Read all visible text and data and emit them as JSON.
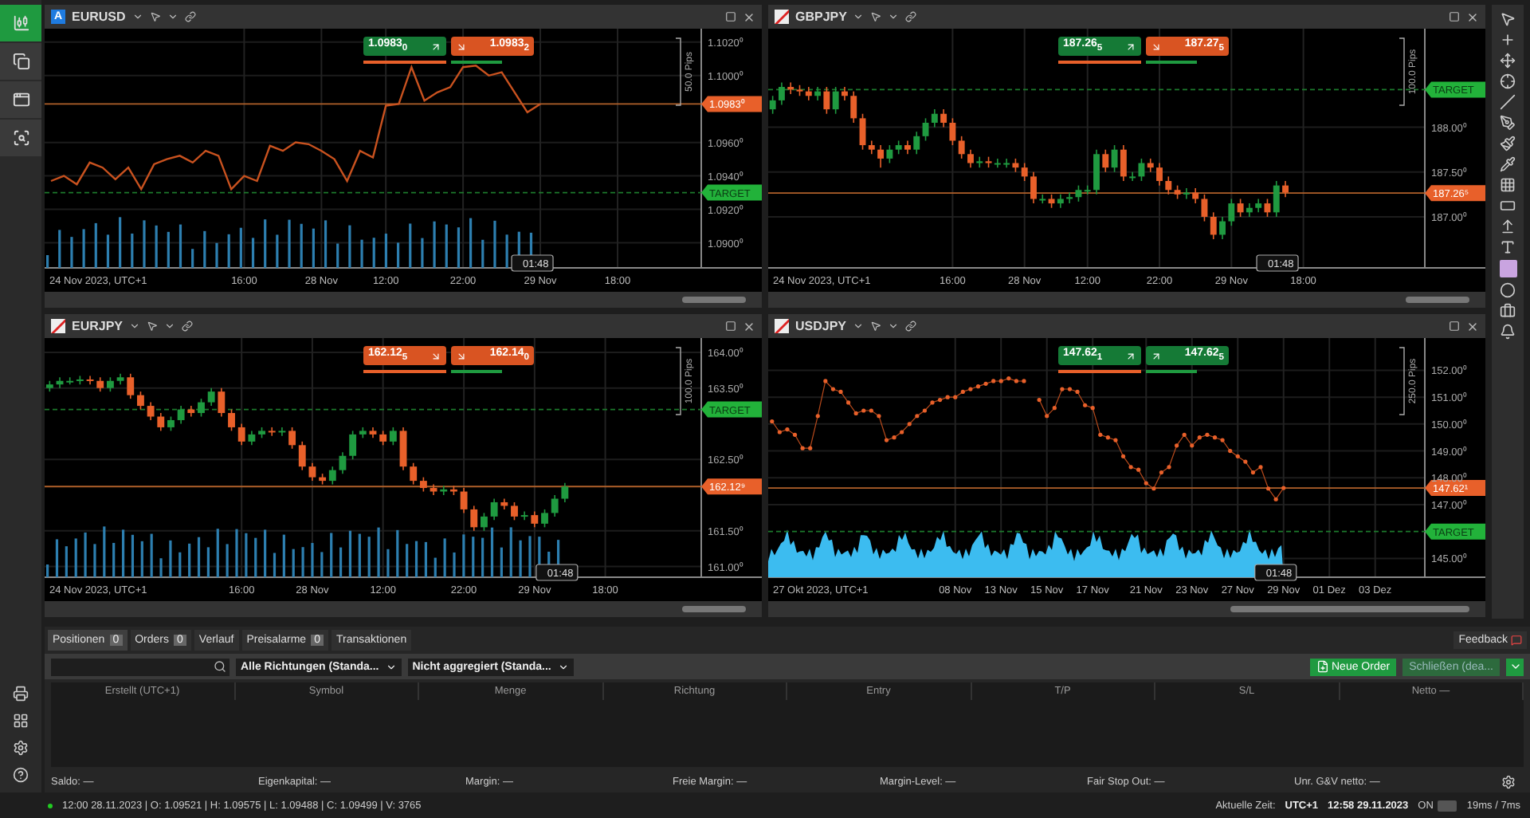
{
  "sidebar": {
    "items": [
      {
        "kind": "chart",
        "selected": true
      },
      {
        "kind": "copy",
        "selected": false
      },
      {
        "kind": "window",
        "selected": false
      },
      {
        "kind": "zoom",
        "selected": false
      }
    ]
  },
  "panes": [
    {
      "symbol": "EURUSD",
      "badge": "A",
      "markers": false,
      "volume": {
        "kind": "bars"
      },
      "pips": "50.0 Pips",
      "time_marker": "01:48",
      "start_label": "24 Nov 2023, UTC+1",
      "quotes": [
        {
          "price": "1.0983$_{0}$",
          "rising": true
        },
        {
          "price": "1.0983$_{2}$",
          "rising": false
        }
      ],
      "chart_data": {
        "type": "line",
        "grid": true,
        "ylim": [
          1.0885,
          1.1028
        ],
        "categories": [
          null,
          null,
          null,
          null,
          null,
          null,
          null,
          null,
          null,
          null,
          null,
          null,
          null,
          null,
          null,
          "16:00",
          null,
          null,
          null,
          null,
          null,
          "28 Nov",
          null,
          null,
          null,
          null,
          "12:00",
          null,
          null,
          null,
          null,
          null,
          "22:00",
          null,
          null,
          null,
          null,
          null,
          "29 Nov",
          null,
          null,
          null,
          null,
          null,
          "18:00",
          null,
          null,
          null,
          null,
          null,
          null
        ],
        "values": [
          1.0937,
          1.094,
          1.0935,
          1.0948,
          1.0945,
          1.0938,
          1.0945,
          1.0932,
          1.0947,
          1.095,
          1.0952,
          1.0948,
          1.0955,
          1.0952,
          1.0932,
          1.094,
          1.0937,
          1.0958,
          1.0955,
          1.096,
          1.0959,
          1.0955,
          1.095,
          1.0937,
          1.0955,
          1.0951,
          1.0982,
          1.0983,
          1.1005,
          1.0985,
          1.099,
          1.0993,
          1.1005,
          1.1006,
          1.1,
          1.1002,
          1.099,
          1.0978,
          1.0983,
          null,
          null,
          null,
          null,
          null,
          null,
          null,
          null,
          null,
          null,
          null,
          null
        ],
        "yticks": [
          {
            "value": 1.09,
            "label": "1.0900⁰"
          },
          {
            "value": 1.092,
            "label": "1.0920⁰"
          },
          {
            "value": 1.094,
            "label": "1.0940⁰"
          },
          {
            "value": 1.096,
            "label": "1.0960⁰"
          },
          {
            "value": 1.1,
            "label": "1.1000⁰"
          },
          {
            "value": 1.102,
            "label": "1.1020⁰"
          }
        ],
        "ref_lines": [
          {
            "axis": "y",
            "value": 1.0983,
            "label": "1.0983⁰"
          },
          {
            "axis": "y",
            "value": 1.093,
            "label": "TARGET"
          }
        ]
      }
    },
    {
      "symbol": "GBPJPY",
      "pips": "100.0 Pips",
      "time_marker": "01:48",
      "start_label": "24 Nov 2023, UTC+1",
      "quotes": [
        {
          "price": "187.26$_{5}$",
          "rising": true
        },
        {
          "price": "187.27$_{5}$",
          "rising": false
        }
      ],
      "chart_data": {
        "type": "candlestick",
        "grid": true,
        "ylim": [
          186.43,
          189.1
        ],
        "categories": [
          null,
          null,
          null,
          null,
          null,
          null,
          null,
          null,
          null,
          null,
          null,
          null,
          null,
          null,
          null,
          null,
          null,
          null,
          null,
          null,
          "16:00",
          null,
          null,
          null,
          null,
          null,
          null,
          null,
          "28 Nov",
          null,
          null,
          null,
          null,
          null,
          null,
          "12:00",
          null,
          null,
          null,
          null,
          null,
          null,
          null,
          "22:00",
          null,
          null,
          null,
          null,
          null,
          null,
          null,
          "29 Nov",
          null,
          null,
          null,
          null,
          null,
          null,
          null,
          "18:00",
          null,
          null,
          null,
          null,
          null,
          null,
          null,
          null,
          null,
          null,
          null,
          null,
          null
        ],
        "ohlc": [
          [
            188.2,
            188.35,
            188.15,
            188.3
          ],
          [
            188.3,
            188.5,
            188.25,
            188.45
          ],
          [
            188.45,
            188.5,
            188.37,
            188.42
          ],
          [
            188.42,
            188.47,
            188.35,
            188.4
          ],
          [
            188.4,
            188.45,
            188.3,
            188.35
          ],
          [
            188.35,
            188.45,
            188.3,
            188.4
          ],
          [
            188.4,
            188.45,
            188.15,
            188.2
          ],
          [
            188.2,
            188.45,
            188.15,
            188.4
          ],
          [
            188.4,
            188.45,
            188.3,
            188.35
          ],
          [
            188.35,
            188.4,
            188.05,
            188.1
          ],
          [
            188.1,
            188.15,
            187.75,
            187.8
          ],
          [
            187.8,
            187.85,
            187.7,
            187.75
          ],
          [
            187.75,
            187.8,
            187.55,
            187.65
          ],
          [
            187.65,
            187.8,
            187.6,
            187.75
          ],
          [
            187.75,
            187.85,
            187.7,
            187.8
          ],
          [
            187.8,
            187.85,
            187.7,
            187.75
          ],
          [
            187.75,
            187.95,
            187.7,
            187.9
          ],
          [
            187.9,
            188.1,
            187.85,
            188.05
          ],
          [
            188.05,
            188.2,
            188.0,
            188.15
          ],
          [
            188.15,
            188.2,
            188.0,
            188.05
          ],
          [
            188.05,
            188.1,
            187.8,
            187.85
          ],
          [
            187.85,
            187.9,
            187.65,
            187.7
          ],
          [
            187.7,
            187.75,
            187.55,
            187.6
          ],
          [
            187.6,
            187.67,
            187.55,
            187.62
          ],
          [
            187.62,
            187.67,
            187.55,
            187.6
          ],
          [
            187.6,
            187.65,
            187.55,
            187.6
          ],
          [
            187.6,
            187.65,
            187.55,
            187.6
          ],
          [
            187.6,
            187.65,
            187.5,
            187.55
          ],
          [
            187.55,
            187.6,
            187.4,
            187.45
          ],
          [
            187.45,
            187.5,
            187.15,
            187.2
          ],
          [
            187.2,
            187.25,
            187.15,
            187.2
          ],
          [
            187.2,
            187.25,
            187.1,
            187.15
          ],
          [
            187.15,
            187.25,
            187.1,
            187.2
          ],
          [
            187.2,
            187.27,
            187.15,
            187.22
          ],
          [
            187.22,
            187.35,
            187.17,
            187.3
          ],
          [
            187.3,
            187.35,
            187.25,
            187.3
          ],
          [
            187.3,
            187.75,
            187.25,
            187.7
          ],
          [
            187.7,
            187.75,
            187.5,
            187.55
          ],
          [
            187.55,
            187.8,
            187.5,
            187.75
          ],
          [
            187.75,
            187.8,
            187.4,
            187.45
          ],
          [
            187.45,
            187.5,
            187.4,
            187.45
          ],
          [
            187.45,
            187.65,
            187.4,
            187.6
          ],
          [
            187.6,
            187.65,
            187.5,
            187.55
          ],
          [
            187.55,
            187.6,
            187.35,
            187.4
          ],
          [
            187.4,
            187.45,
            187.25,
            187.3
          ],
          [
            187.3,
            187.35,
            187.2,
            187.25
          ],
          [
            187.25,
            187.32,
            187.2,
            187.27
          ],
          [
            187.27,
            187.32,
            187.15,
            187.2
          ],
          [
            187.2,
            187.25,
            186.95,
            187.0
          ],
          [
            187.0,
            187.05,
            186.75,
            186.8
          ],
          [
            186.8,
            187.0,
            186.75,
            186.95
          ],
          [
            186.95,
            187.2,
            186.9,
            187.15
          ],
          [
            187.15,
            187.2,
            187.0,
            187.05
          ],
          [
            187.05,
            187.15,
            187.0,
            187.1
          ],
          [
            187.1,
            187.2,
            187.05,
            187.15
          ],
          [
            187.15,
            187.2,
            187.0,
            187.05
          ],
          [
            187.05,
            187.4,
            187.0,
            187.35
          ],
          [
            187.35,
            187.4,
            187.22,
            187.27
          ],
          null,
          null,
          null,
          null,
          null,
          null,
          null,
          null,
          null,
          null,
          null,
          null,
          null,
          null,
          null
        ],
        "yticks": [
          {
            "value": 187,
            "label": "187.00⁰"
          },
          {
            "value": 187.5,
            "label": "187.50⁰"
          },
          {
            "value": 188,
            "label": "188.00⁰"
          }
        ],
        "ref_lines": [
          {
            "axis": "y",
            "value": 187.265,
            "label": "187.26⁵"
          },
          {
            "axis": "y",
            "value": 188.42,
            "label": "TARGET"
          }
        ]
      }
    },
    {
      "symbol": "EURJPY",
      "volume": {
        "kind": "bars"
      },
      "pips": "100.0 Pips",
      "time_marker": "01:48",
      "start_label": "24 Nov 2023, UTC+1",
      "quotes": [
        {
          "price": "162.12$_{5}$",
          "rising": false
        },
        {
          "price": "162.14$_{0}$",
          "rising": false
        }
      ],
      "chart_data": {
        "type": "candlestick",
        "grid": true,
        "ylim": [
          160.85,
          164.2
        ],
        "categories": [
          null,
          null,
          null,
          null,
          null,
          null,
          null,
          null,
          null,
          null,
          null,
          null,
          null,
          null,
          null,
          null,
          null,
          null,
          null,
          "16:00",
          null,
          null,
          null,
          null,
          null,
          null,
          "28 Nov",
          null,
          null,
          null,
          null,
          null,
          null,
          "12:00",
          null,
          null,
          null,
          null,
          null,
          null,
          null,
          "22:00",
          null,
          null,
          null,
          null,
          null,
          null,
          "29 Nov",
          null,
          null,
          null,
          null,
          null,
          null,
          "18:00",
          null,
          null,
          null,
          null,
          null,
          null,
          null,
          null,
          null
        ],
        "ohlc": [
          [
            163.5,
            163.6,
            163.45,
            163.55
          ],
          [
            163.55,
            163.65,
            163.5,
            163.6
          ],
          [
            163.6,
            163.65,
            163.55,
            163.6
          ],
          [
            163.6,
            163.67,
            163.55,
            163.62
          ],
          [
            163.62,
            163.67,
            163.55,
            163.6
          ],
          [
            163.6,
            163.65,
            163.45,
            163.5
          ],
          [
            163.5,
            163.65,
            163.45,
            163.6
          ],
          [
            163.6,
            163.7,
            163.55,
            163.65
          ],
          [
            163.65,
            163.7,
            163.35,
            163.4
          ],
          [
            163.4,
            163.45,
            163.2,
            163.25
          ],
          [
            163.25,
            163.3,
            163.05,
            163.1
          ],
          [
            163.1,
            163.15,
            162.9,
            162.95
          ],
          [
            162.95,
            163.1,
            162.9,
            163.05
          ],
          [
            163.05,
            163.25,
            163.0,
            163.2
          ],
          [
            163.2,
            163.25,
            163.1,
            163.15
          ],
          [
            163.15,
            163.35,
            163.1,
            163.3
          ],
          [
            163.3,
            163.5,
            163.25,
            163.45
          ],
          [
            163.45,
            163.5,
            163.1,
            163.15
          ],
          [
            163.15,
            163.2,
            162.9,
            162.95
          ],
          [
            162.95,
            163.0,
            162.7,
            162.75
          ],
          [
            162.75,
            162.9,
            162.7,
            162.85
          ],
          [
            162.85,
            162.95,
            162.8,
            162.9
          ],
          [
            162.9,
            162.95,
            162.83,
            162.88
          ],
          [
            162.88,
            162.95,
            162.83,
            162.9
          ],
          [
            162.9,
            162.95,
            162.65,
            162.7
          ],
          [
            162.7,
            162.75,
            162.35,
            162.4
          ],
          [
            162.4,
            162.45,
            162.2,
            162.25
          ],
          [
            162.25,
            162.3,
            162.15,
            162.2
          ],
          [
            162.2,
            162.4,
            162.15,
            162.35
          ],
          [
            162.35,
            162.6,
            162.3,
            162.55
          ],
          [
            162.55,
            162.9,
            162.5,
            162.85
          ],
          [
            162.85,
            162.95,
            162.8,
            162.9
          ],
          [
            162.9,
            162.95,
            162.8,
            162.85
          ],
          [
            162.85,
            162.9,
            162.7,
            162.75
          ],
          [
            162.75,
            162.95,
            162.7,
            162.9
          ],
          [
            162.9,
            162.95,
            162.35,
            162.4
          ],
          [
            162.4,
            162.45,
            162.15,
            162.2
          ],
          [
            162.2,
            162.25,
            162.05,
            162.1
          ],
          [
            162.1,
            162.15,
            162.0,
            162.05
          ],
          [
            162.05,
            162.13,
            162.0,
            162.08
          ],
          [
            162.08,
            162.13,
            162.0,
            162.05
          ],
          [
            162.05,
            162.1,
            161.75,
            161.8
          ],
          [
            161.8,
            161.85,
            161.5,
            161.55
          ],
          [
            161.55,
            161.75,
            161.5,
            161.7
          ],
          [
            161.7,
            161.95,
            161.65,
            161.9
          ],
          [
            161.9,
            161.95,
            161.8,
            161.85
          ],
          [
            161.85,
            161.9,
            161.65,
            161.7
          ],
          [
            161.7,
            161.77,
            161.65,
            161.72
          ],
          [
            161.72,
            161.77,
            161.55,
            161.6
          ],
          [
            161.6,
            161.8,
            161.55,
            161.75
          ],
          [
            161.75,
            162.0,
            161.7,
            161.95
          ],
          [
            161.95,
            162.17,
            161.9,
            162.12
          ],
          null,
          null,
          null,
          null,
          null,
          null,
          null,
          null,
          null,
          null,
          null,
          null,
          null
        ],
        "yticks": [
          {
            "value": 161,
            "label": "161.00⁰"
          },
          {
            "value": 161.5,
            "label": "161.50⁰"
          },
          {
            "value": 162.5,
            "label": "162.50⁰"
          },
          {
            "value": 163.5,
            "label": "163.50⁰"
          },
          {
            "value": 164,
            "label": "164.00⁰"
          }
        ],
        "ref_lines": [
          {
            "axis": "y",
            "value": 162.12,
            "label": "162.12⁹"
          },
          {
            "axis": "y",
            "value": 163.2,
            "label": "TARGET"
          }
        ]
      }
    },
    {
      "symbol": "USDJPY",
      "volume": {
        "kind": "area"
      },
      "pips": "250.0 Pips",
      "time_marker": "01:48",
      "start_label": "27 Okt 2023, UTC+1",
      "quotes": [
        {
          "price": "147.62$_{1}$",
          "rising": true
        },
        {
          "price": "147.62$_{5}$",
          "rising": true
        }
      ],
      "markers": true,
      "chart_data": {
        "type": "line",
        "grid": true,
        "ylim": [
          144.3,
          153.2
        ],
        "categories": [
          null,
          null,
          null,
          null,
          null,
          null,
          null,
          null,
          null,
          null,
          null,
          null,
          null,
          null,
          null,
          null,
          null,
          null,
          null,
          null,
          null,
          null,
          null,
          null,
          "08 Nov",
          null,
          null,
          null,
          null,
          null,
          "13 Nov",
          null,
          null,
          null,
          null,
          null,
          "15 Nov",
          null,
          null,
          null,
          null,
          null,
          "17 Nov",
          null,
          null,
          null,
          null,
          null,
          null,
          "21 Nov",
          null,
          null,
          null,
          null,
          null,
          "23 Nov",
          null,
          null,
          null,
          null,
          null,
          "27 Nov",
          null,
          null,
          null,
          null,
          null,
          "29 Nov",
          null,
          null,
          null,
          null,
          null,
          "01 Dez",
          null,
          null,
          null,
          null,
          null,
          "03 Dez",
          null,
          null,
          null,
          null,
          null,
          null
        ],
        "values": [
          150.1,
          149.7,
          149.8,
          149.6,
          149.1,
          149.1,
          150.3,
          151.6,
          151.3,
          151.2,
          150.8,
          150.4,
          150.5,
          150.5,
          150.3,
          149.4,
          149.5,
          149.7,
          150.0,
          150.3,
          150.5,
          150.8,
          150.9,
          151.0,
          151.0,
          151.2,
          151.3,
          151.4,
          151.5,
          151.6,
          151.6,
          151.7,
          151.6,
          151.6,
          null,
          150.9,
          150.3,
          150.6,
          151.3,
          151.3,
          151.2,
          150.7,
          150.6,
          149.6,
          149.5,
          149.4,
          148.8,
          148.4,
          148.3,
          147.8,
          147.6,
          148.2,
          148.4,
          149.2,
          149.6,
          149.2,
          149.5,
          149.6,
          149.5,
          149.4,
          149.0,
          148.8,
          148.6,
          148.2,
          148.4,
          147.6,
          147.2,
          147.62,
          null,
          null,
          null,
          null,
          null,
          null,
          null,
          null,
          null,
          null,
          null,
          null,
          null,
          null,
          null,
          null,
          null,
          null
        ],
        "yticks": [
          {
            "value": 145,
            "label": "145.00⁰"
          },
          {
            "value": 147,
            "label": "147.00⁰"
          },
          {
            "value": 148,
            "label": "148.00⁰"
          },
          {
            "value": 149,
            "label": "149.00⁰"
          },
          {
            "value": 150,
            "label": "150.00⁰"
          },
          {
            "value": 151,
            "label": "151.00⁰"
          },
          {
            "value": 152,
            "label": "152.00⁰"
          }
        ],
        "ref_lines": [
          {
            "axis": "y",
            "value": 147.62,
            "label": "147.62¹"
          },
          {
            "axis": "y",
            "value": 146.0,
            "label": "TARGET"
          }
        ]
      }
    }
  ],
  "bottom_tabs": [
    {
      "label": "Positionen",
      "count": "0",
      "selected": true
    },
    {
      "label": "Orders",
      "count": "0",
      "selected": false
    },
    {
      "label": "Verlauf",
      "selected": false
    },
    {
      "label": "Preisalarme",
      "count": "0",
      "selected": false
    },
    {
      "label": "Transaktionen",
      "selected": false
    }
  ],
  "feedback": "Feedback",
  "filters": [
    "Alle Richtungen (Standa...",
    "Nicht aggregiert (Standa..."
  ],
  "new_order": "Neue Order",
  "close_button": {
    "label": "Schließen (dea...",
    "disabled": true
  },
  "table": {
    "columns": [
      "Erstellt (UTC+1)",
      "Symbol",
      "Menge",
      "Richtung",
      "Entry",
      "T/P",
      "S/L",
      "Netto —"
    ]
  },
  "summary": [
    "Saldo: —",
    "Eigenkapital: —",
    "Margin: —",
    "Freie Margin: —",
    "Margin-Level: —",
    "Fair Stop Out: —",
    "Unr. G&V netto: —"
  ],
  "status_bar": {
    "candle": "12:00 28.11.2023 | O: 1.09521 | H: 1.09575 | L: 1.09488 | C: 1.09499 | V: 3765",
    "time_label": "Aktuelle Zeit:",
    "timezone": "UTC+1",
    "time": "12:58 29.11.2023",
    "toggle": {
      "label": "ON",
      "on": true
    },
    "latency": "19ms / 7ms"
  }
}
